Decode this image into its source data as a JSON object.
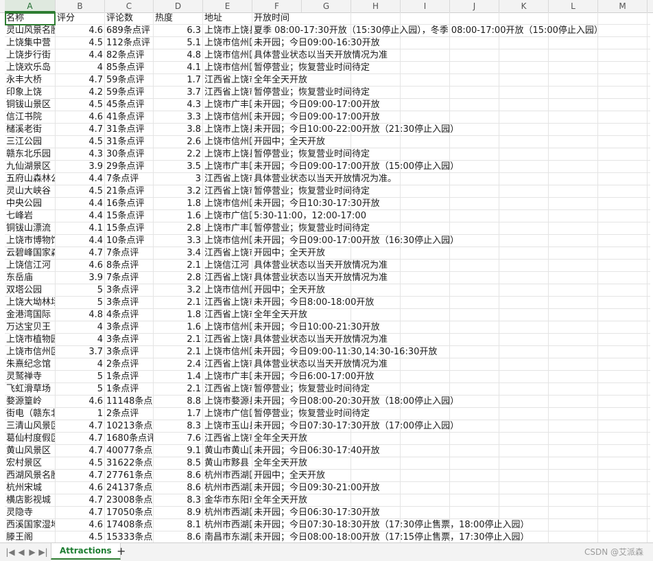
{
  "columns": [
    "A",
    "B",
    "C",
    "D",
    "E",
    "F",
    "G",
    "H",
    "I",
    "J",
    "K",
    "L",
    "M"
  ],
  "active_column": "A",
  "rows": [
    [
      "名称",
      "评分",
      "评论数",
      "热度",
      "地址",
      "开放时间"
    ],
    [
      "灵山风景名胜区",
      "4.6",
      "689条点评",
      "6.3",
      "上饶市上饶县",
      "夏季 08:00-17:30开放（15:30停止入园），冬季 08:00-17:00开放（15:00停止入园）"
    ],
    [
      "上饶集中营",
      "4.5",
      "112条点评",
      "5.1",
      "上饶市信州区",
      "未开园；今日09:00-16:30开放"
    ],
    [
      "上饶步行街",
      "4.4",
      "82条点评",
      "4.8",
      "上饶市信州区",
      "具体营业状态以当天开放情况为准"
    ],
    [
      "上饶欢乐岛",
      "4",
      "85条点评",
      "4.1",
      "上饶市信州区",
      "暂停营业；恢复营业时间待定"
    ],
    [
      "永丰大桥",
      "4.7",
      "59条点评",
      "1.7",
      "江西省上饶市",
      "全年全天开放"
    ],
    [
      "印象上饶",
      "4.2",
      "59条点评",
      "3.7",
      "江西省上饶市",
      "暂停营业；恢复营业时间待定"
    ],
    [
      "铜钹山景区",
      "4.5",
      "45条点评",
      "4.3",
      "上饶市广丰区",
      "未开园；今日09:00-17:00开放"
    ],
    [
      "信江书院",
      "4.6",
      "41条点评",
      "3.3",
      "上饶市信州区",
      "未开园；今日09:00-17:00开放"
    ],
    [
      "槠溪老街",
      "4.7",
      "31条点评",
      "3.8",
      "上饶市上饶县",
      "未开园；今日10:00-22:00开放（21:30停止入园）"
    ],
    [
      "三江公园",
      "4.5",
      "31条点评",
      "2.6",
      "上饶市信州区",
      "开园中；全天开放"
    ],
    [
      "赣东北乐园",
      "4.3",
      "30条点评",
      "2.2",
      "上饶市上饶县",
      "暂停营业；恢复营业时间待定"
    ],
    [
      "九仙湖景区",
      "3.9",
      "29条点评",
      "3.5",
      "上饶市广丰区",
      "未开园；今日09:00-17:00开放（15:00停止入园）"
    ],
    [
      "五府山森林公园",
      "4.4",
      "7条点评",
      "3",
      "江西省上饶市",
      "具体营业状态以当天开放情况为准。"
    ],
    [
      "灵山大峡谷",
      "4.5",
      "21条点评",
      "3.2",
      "江西省上饶市",
      "暂停营业；恢复营业时间待定"
    ],
    [
      "中央公园",
      "4.4",
      "16条点评",
      "1.8",
      "上饶市信州区",
      "未开园；今日10:30-17:30开放"
    ],
    [
      "七峰岩",
      "4.4",
      "15条点评",
      "1.6",
      "上饶市广信区",
      "5:30-11:00，12:00-17:00"
    ],
    [
      "铜钹山漂流",
      "4.1",
      "15条点评",
      "2.8",
      "上饶市广丰区",
      "暂停营业；恢复营业时间待定"
    ],
    [
      "上饶市博物馆",
      "4.4",
      "10条点评",
      "3.3",
      "上饶市信州区",
      "未开园；今日09:00-17:00开放（16:30停止入园）"
    ],
    [
      "云碧峰国家森林公园",
      "4.7",
      "7条点评",
      "3.4",
      "江西省上饶市",
      "开园中；全天开放"
    ],
    [
      "上饶信江河",
      "4.6",
      "8条点评",
      "2.1",
      "上饶信江河",
      "具体营业状态以当天开放情况为准"
    ],
    [
      "东岳庙",
      "3.9",
      "7条点评",
      "2.8",
      "江西省上饶市",
      "具体营业状态以当天开放情况为准"
    ],
    [
      "双塔公园",
      "5",
      "3条点评",
      "3.2",
      "上饶市信州区",
      "开园中；全天开放"
    ],
    [
      "上饶大坳林场",
      "5",
      "3条点评",
      "2.1",
      "江西省上饶市",
      "未开园；今日8:00-18:00开放"
    ],
    [
      "金港湾国际",
      "4.8",
      "4条点评",
      "1.8",
      "江西省上饶市",
      "全年全天开放"
    ],
    [
      "万达宝贝王",
      "4",
      "3条点评",
      "1.6",
      "上饶市信州区",
      "未开园；今日10:00-21:30开放"
    ],
    [
      "上饶市植物园",
      "4",
      "3条点评",
      "2.1",
      "江西省上饶市",
      "具体营业状态以当天开放情况为准"
    ],
    [
      "上饶市信州区",
      "3.7",
      "3条点评",
      "2.1",
      "上饶市信州区",
      "未开园；今日09:00-11:30,14:30-16:30开放"
    ],
    [
      "朱熹纪念馆",
      "4",
      "2条点评",
      "2.4",
      "江西省上饶市",
      "具体营业状态以当天开放情况为准"
    ],
    [
      "灵鹫禅寺",
      "5",
      "1条点评",
      "1.4",
      "上饶市广丰区",
      "未开园；今日6:00-17:00开放"
    ],
    [
      "飞虹滑草场",
      "5",
      "1条点评",
      "2.1",
      "江西省上饶市",
      "暂停营业；恢复营业时间待定"
    ],
    [
      "婺源篁岭",
      "4.6",
      "11148条点评",
      "8.8",
      "上饶市婺源县",
      "未开园；今日08:00-20:30开放（18:00停止入园）"
    ],
    [
      "街电（赣东北）",
      "1",
      "2条点评",
      "1.7",
      "上饶市广信区",
      "暂停营业；恢复营业时间待定"
    ],
    [
      "三清山风景区",
      "4.7",
      "10213条点评",
      "8.3",
      "上饶市玉山县",
      "未开园；今日07:30-17:30开放（17:00停止入园）"
    ],
    [
      "葛仙村度假区",
      "4.7",
      "1680条点评",
      "7.6",
      "江西省上饶市",
      "全年全天开放"
    ],
    [
      "黄山风景区",
      "4.7",
      "40077条点评",
      "9.1",
      "黄山市黄山区",
      "未开园；今日06:30-17:40开放"
    ],
    [
      "宏村景区",
      "4.5",
      "31622条点评",
      "8.5",
      "黄山市黟县",
      "全年全天开放"
    ],
    [
      "西湖风景名胜区",
      "4.7",
      "27761条点评",
      "8.6",
      "杭州市西湖区",
      "开园中；全天开放"
    ],
    [
      "杭州宋城",
      "4.6",
      "24137条点评",
      "8.6",
      "杭州市西湖区",
      "未开园；今日09:30-21:00开放"
    ],
    [
      "横店影视城",
      "4.7",
      "23008条点评",
      "8.3",
      "金华市东阳市",
      "全年全天开放"
    ],
    [
      "灵隐寺",
      "4.7",
      "17050条点评",
      "8.9",
      "杭州市西湖区",
      "未开园；今日06:30-17:30开放"
    ],
    [
      "西溪国家湿地公园",
      "4.6",
      "17408条点评",
      "8.1",
      "杭州市西湖区",
      "未开园；今日07:30-18:30开放（17:30停止售票，18:00停止入园）"
    ],
    [
      "滕王阁",
      "4.5",
      "15333条点评",
      "8.6",
      "南昌市东湖区",
      "未开园；今日08:00-18:00开放（17:15停止售票，17:30停止入园）"
    ]
  ],
  "sheet_tab": "Attractions",
  "add_tab_label": "+",
  "nav": [
    "|◀",
    "◀",
    "▶",
    "▶|"
  ],
  "watermark": "CSDN @艾派森"
}
